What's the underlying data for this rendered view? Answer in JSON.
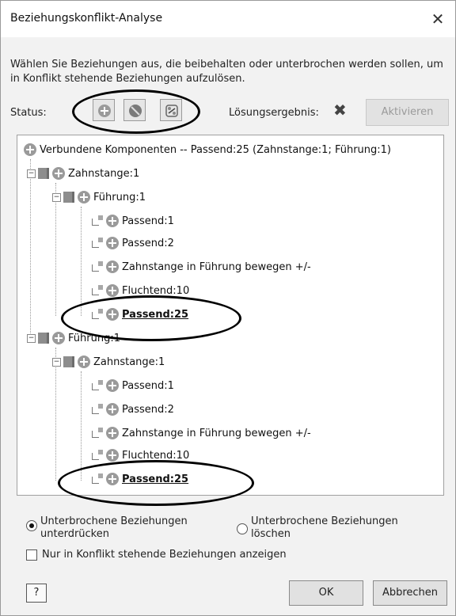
{
  "window": {
    "title": "Beziehungskonflikt-Analyse",
    "close_label": "✕"
  },
  "description": "Wählen Sie Beziehungen aus, die beibehalten oder unterbrochen werden sollen, um in Konflikt stehende Beziehungen aufzulösen.",
  "status": {
    "label": "Status:",
    "buttons": [
      "plus-status-icon",
      "suppress-status-icon",
      "broken-link-status-icon"
    ]
  },
  "result": {
    "label": "Lösungsergebnis:",
    "icon_glyph": "✖",
    "activate_label": "Aktivieren"
  },
  "tree": {
    "root": "Verbundene Komponenten -- Passend:25 (Zahnstange:1; Führung:1)",
    "g1": {
      "label": "Zahnstange:1",
      "child": "Führung:1",
      "items": [
        "Passend:1",
        "Passend:2",
        "Zahnstange in Führung bewegen +/-",
        "Fluchtend:10",
        "Passend:25"
      ]
    },
    "g2": {
      "label": "Führung:1",
      "child": "Zahnstange:1",
      "items": [
        "Passend:1",
        "Passend:2",
        "Zahnstange in Führung bewegen +/-",
        "Fluchtend:10",
        "Passend:25"
      ]
    }
  },
  "options": {
    "radio1": "Unterbrochene Beziehungen unterdrücken",
    "radio1_line1": "Unterbrochene Beziehungen",
    "radio1_line2": "unterdrücken",
    "radio2_line1": "Unterbrochene Beziehungen",
    "radio2_line2": "löschen",
    "selected": "radio1",
    "checkbox": "Nur in Konflikt stehende Beziehungen anzeigen",
    "checkbox_checked": false
  },
  "footer": {
    "help_label": "?",
    "ok_label": "OK",
    "cancel_label": "Abbrechen"
  }
}
